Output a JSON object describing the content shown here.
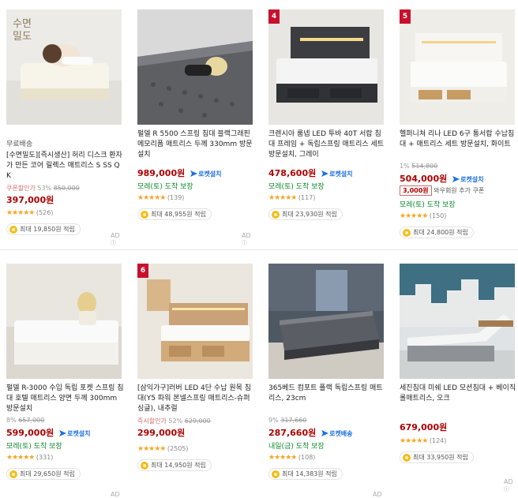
{
  "badges": {
    "free_label": "무료배송",
    "rocket_label": "로켓설치",
    "rocket_delivery_label": "로켓배송",
    "ad_label": "AD"
  },
  "cards": [
    {
      "rank": "",
      "image_overlay": "수면\n밀도",
      "free": "무료배송",
      "title": "[수면밀도][즉시생산] 허리 디스크 환자가 만든 코어 릴렉스 매트리스 S SS Q K",
      "discount_label": "쿠폰할인가",
      "discount_rate": "53%",
      "original_price": "850,000",
      "price": "397,000원",
      "rocket": "",
      "coupon": "",
      "delivery": "",
      "stars": "★★★★★",
      "reviews": "(526)",
      "points": "최대 19,850원 적립",
      "ad": true
    },
    {
      "rank": "",
      "free": "",
      "title": "펄델 R 5500 스프링 침대 블랙그래핀 메모리폼 매트리스 두께 330mm 방문설치",
      "discount_label": "",
      "discount_rate": "",
      "original_price": "",
      "price": "989,000원",
      "rocket": "로켓설치",
      "coupon": "",
      "delivery": "모레(토) 도착 보장",
      "stars": "★★★★★",
      "reviews": "(139)",
      "points": "최대 48,955원 적립",
      "ad": true
    },
    {
      "rank": "4",
      "free": "",
      "title": "크렌시아 룸넵 LED 투바 40T 서랍 침대 프레임 + 독립스프링 매트리스 세트 방문설치, 그레이",
      "discount_label": "",
      "discount_rate": "",
      "original_price": "",
      "price": "478,600원",
      "rocket": "로켓설치",
      "coupon": "",
      "delivery": "모레(토) 도착 보장",
      "stars": "★★★★★",
      "reviews": "(117)",
      "points": "최대 23,930원 적립",
      "ad": false
    },
    {
      "rank": "5",
      "free": "",
      "title": "헬퍼니쳐 리나 LED 6구 통서랍 수납침대 + 매트리스 세트 방문설치, 화이트",
      "discount_label": "",
      "discount_rate": "1%",
      "original_price": "514,800",
      "price": "504,000원",
      "rocket": "로켓설치",
      "coupon_tag": "3,000원",
      "coupon": "와우회원 추가 쿠폰",
      "delivery": "모레(토) 도착 보장",
      "stars": "★★★★★",
      "reviews": "(150)",
      "points": "최대 24,800원 적립",
      "ad": false
    },
    {
      "rank": "",
      "free": "",
      "title": "펄델 R-3000 수입 독립 포켓 스프링 침대 호텔 매트리스 양면 두께 300mm 방문설치",
      "discount_label": "",
      "discount_rate": "8%",
      "original_price": "657,000",
      "price": "599,000원",
      "rocket": "로켓설치",
      "coupon": "",
      "delivery": "모레(토) 도착 보장",
      "stars": "★★★★★",
      "reviews": "(331)",
      "points": "최대 29,650원 적립",
      "ad": true
    },
    {
      "rank": "6",
      "free": "",
      "title": "[삼익가구]러버 LED 4단 수납 원목 침대(Y5 파워 본넬스프링 매트리스-슈퍼싱글), 내추럴",
      "discount_label": "즉시할인가",
      "discount_rate": "52%",
      "original_price": "629,000",
      "price": "299,000원",
      "rocket": "",
      "coupon": "",
      "delivery": "",
      "stars": "★★★★★",
      "reviews": "(2505)",
      "points": "최대 14,950원 적립",
      "ad": false
    },
    {
      "rank": "",
      "free": "",
      "title": "365베드 컴포트 플랙 독립스프링 매트리스, 23cm",
      "discount_label": "",
      "discount_rate": "9%",
      "original_price": "317,660",
      "price": "287,660원",
      "rocket": "로켓배송",
      "coupon": "",
      "delivery": "내일(금) 도착 보장",
      "stars": "★★★★★",
      "reviews": "(108)",
      "points": "최대 14,383원 적립",
      "ad": true
    },
    {
      "rank": "",
      "free": "",
      "title": "세진침대 미쉐 LED 모션침대 + 베이직롤매트리스, 오크",
      "discount_label": "",
      "discount_rate": "",
      "original_price": "",
      "price": "679,000원",
      "rocket": "",
      "coupon": "",
      "delivery": "",
      "stars": "★★★★★",
      "reviews": "(124)",
      "points": "최대 33,950원 적립",
      "ad": true
    }
  ],
  "colors": {
    "price": "#ae0000",
    "delivery": "#0a8a2a",
    "rocket": "#1b6fe0",
    "rank_badge": "#c8102e",
    "star": "#f5a623"
  }
}
